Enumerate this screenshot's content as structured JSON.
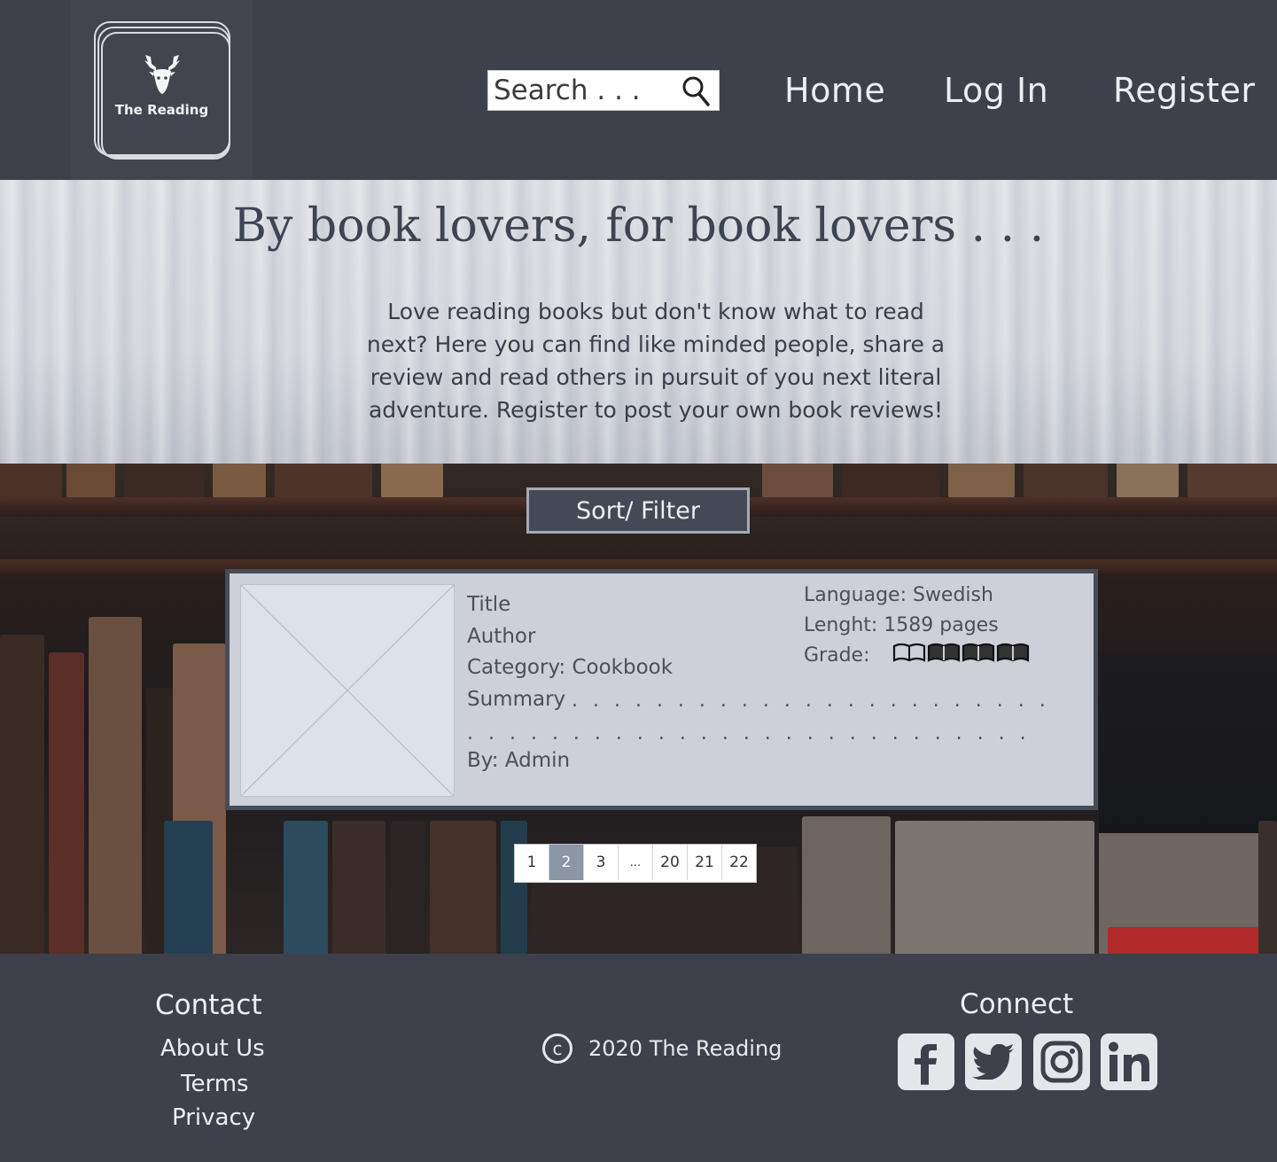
{
  "header": {
    "logo_text": "The Reading",
    "search_placeholder": "Search . . .",
    "nav": {
      "home": "Home",
      "login": "Log In",
      "register": "Register"
    }
  },
  "hero": {
    "title": "By book lovers, for book lovers . . .",
    "text": "Love reading books but don't know what to read next? Here you can find like minded people, share a review and read others in pursuit of you next literal adventure. Register to post your own book reviews!"
  },
  "sort_filter_label": "Sort/ Filter",
  "review": {
    "title": "Title",
    "author": "Author",
    "category": "Category: Cookbook",
    "summary_label": "Summary",
    "by": "By: Admin",
    "language": "Language: Swedish",
    "length": "Lenght: 1589 pages",
    "grade_label": "Grade:",
    "grade": 3,
    "grade_max": 4
  },
  "pagination": {
    "pages": [
      "1",
      "2",
      "3",
      "...",
      "20",
      "21",
      "22"
    ],
    "active": "2"
  },
  "footer": {
    "contact_heading": "Contact",
    "about": "About Us",
    "terms": "Terms",
    "privacy": "Privacy",
    "copyright": "2020 The Reading",
    "copyright_symbol": "c",
    "connect_heading": "Connect",
    "social_icons": [
      "facebook-icon",
      "twitter-icon",
      "instagram-icon",
      "linkedin-icon"
    ]
  },
  "colors": {
    "header_bg": "#3e414b",
    "accent": "#8b96a7",
    "card_bg": "#cdd0d8"
  }
}
